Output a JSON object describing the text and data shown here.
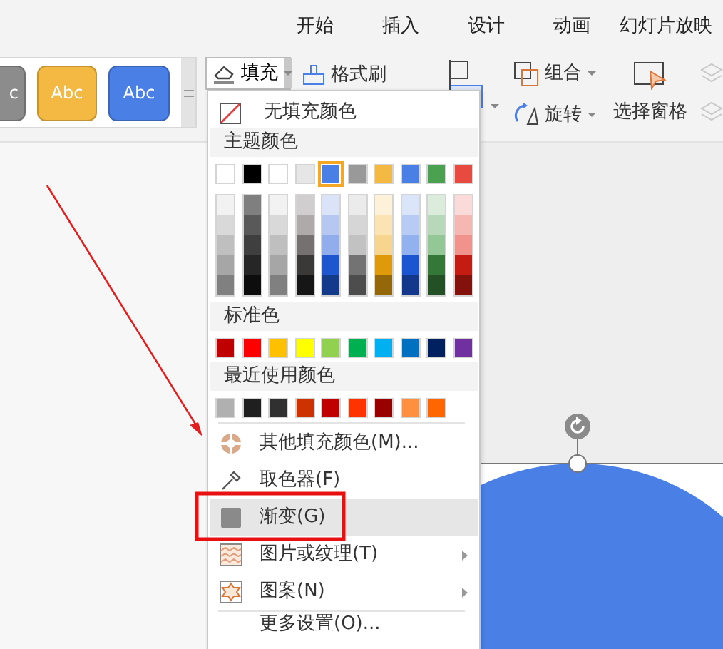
{
  "tabs": [
    {
      "label": "开始"
    },
    {
      "label": "插入"
    },
    {
      "label": "设计"
    },
    {
      "label": "动画"
    },
    {
      "label": "幻灯片放映"
    }
  ],
  "style_gallery": [
    {
      "text": "c",
      "color": "#8c8c8c"
    },
    {
      "text": "Abc",
      "color": "#f4b942"
    },
    {
      "text": "Abc",
      "color": "#4a7fe5"
    }
  ],
  "toolbar": {
    "fill": {
      "label": "填充",
      "open": true
    },
    "format_painter": {
      "label": "格式刷"
    },
    "group": {
      "label": "组合"
    },
    "rotate": {
      "label": "旋转"
    },
    "selection_pane": {
      "label": "选择窗格"
    },
    "bring_forward": {
      "disabled": true
    },
    "send_backward": {
      "disabled": true
    }
  },
  "fill_menu": {
    "no_fill": "无填充颜色",
    "theme_header": "主题颜色",
    "theme_colors": [
      {
        "color": "#ffffff",
        "selected": false
      },
      {
        "color": "#000000",
        "selected": false
      },
      {
        "color": "#ffffff",
        "selected": false
      },
      {
        "color": "#e7e6e6",
        "selected": false
      },
      {
        "color": "#4a7fe5",
        "selected": true
      },
      {
        "color": "#999999",
        "selected": false
      },
      {
        "color": "#f4b942",
        "selected": false
      },
      {
        "color": "#4a7fe5",
        "selected": false
      },
      {
        "color": "#4aa150",
        "selected": false
      },
      {
        "color": "#e84a3f",
        "selected": false
      }
    ],
    "theme_shades": [
      [
        {
          "color": "#f2f2f2"
        },
        {
          "color": "#d9d9d9"
        },
        {
          "color": "#bfbfbf"
        },
        {
          "color": "#a6a6a6"
        },
        {
          "color": "#808080"
        }
      ],
      [
        {
          "color": "#7f7f7f"
        },
        {
          "color": "#595959"
        },
        {
          "color": "#3f3f3f"
        },
        {
          "color": "#262626"
        },
        {
          "color": "#0d0d0d"
        }
      ],
      [
        {
          "color": "#f2f2f2"
        },
        {
          "color": "#d9d9d9"
        },
        {
          "color": "#bfbfbf"
        },
        {
          "color": "#a6a6a6"
        },
        {
          "color": "#808080"
        }
      ],
      [
        {
          "color": "#d0cece"
        },
        {
          "color": "#aeaaaa"
        },
        {
          "color": "#767171"
        },
        {
          "color": "#3b3838"
        },
        {
          "color": "#171616"
        }
      ],
      [
        {
          "color": "#dae3f8"
        },
        {
          "color": "#b6c8f2"
        },
        {
          "color": "#91adeb"
        },
        {
          "color": "#1e56d0"
        },
        {
          "color": "#143a8b"
        }
      ],
      [
        {
          "color": "#ebebeb"
        },
        {
          "color": "#d6d6d6"
        },
        {
          "color": "#c2c2c2"
        },
        {
          "color": "#737373"
        },
        {
          "color": "#4d4d4d"
        }
      ],
      [
        {
          "color": "#fdf1d9"
        },
        {
          "color": "#fbe3b3"
        },
        {
          "color": "#f8d58e"
        },
        {
          "color": "#df9a0c"
        },
        {
          "color": "#946708"
        }
      ],
      [
        {
          "color": "#dbe5fa"
        },
        {
          "color": "#b7cbf5"
        },
        {
          "color": "#92b2ef"
        },
        {
          "color": "#1c55d1"
        },
        {
          "color": "#13388b"
        }
      ],
      [
        {
          "color": "#dbecdc"
        },
        {
          "color": "#b7d9b9"
        },
        {
          "color": "#93c796"
        },
        {
          "color": "#347838"
        },
        {
          "color": "#235025"
        }
      ],
      [
        {
          "color": "#fadbd9"
        },
        {
          "color": "#f6b7b2"
        },
        {
          "color": "#f1928c"
        },
        {
          "color": "#c41c12"
        },
        {
          "color": "#83120c"
        }
      ]
    ],
    "standard_header": "标准色",
    "standard_colors": [
      {
        "color": "#c00000"
      },
      {
        "color": "#ff0000"
      },
      {
        "color": "#ffc000"
      },
      {
        "color": "#ffff00"
      },
      {
        "color": "#92d050"
      },
      {
        "color": "#00b050"
      },
      {
        "color": "#00b0f0"
      },
      {
        "color": "#0070c0"
      },
      {
        "color": "#002060"
      },
      {
        "color": "#7030a0"
      }
    ],
    "recent_header": "最近使用颜色",
    "recent_colors": [
      {
        "color": "#b0b0b0"
      },
      {
        "color": "#1f1f1f"
      },
      {
        "color": "#303030"
      },
      {
        "color": "#cc3300"
      },
      {
        "color": "#c00000"
      },
      {
        "color": "#ff3300"
      },
      {
        "color": "#990000"
      },
      {
        "color": "#ff9040"
      },
      {
        "color": "#ff6600"
      }
    ],
    "items": [
      {
        "label": "其他填充颜色(M)...",
        "submenu": false,
        "selected": false
      },
      {
        "label": "取色器(F)",
        "submenu": false,
        "selected": false
      },
      {
        "label": "渐变(G)",
        "submenu": false,
        "selected": true
      },
      {
        "label": "图片或纹理(T)",
        "submenu": true,
        "selected": false
      },
      {
        "label": "图案(N)",
        "submenu": true,
        "selected": false
      },
      {
        "label": "更多设置(O)...",
        "submenu": false,
        "selected": false
      }
    ]
  }
}
